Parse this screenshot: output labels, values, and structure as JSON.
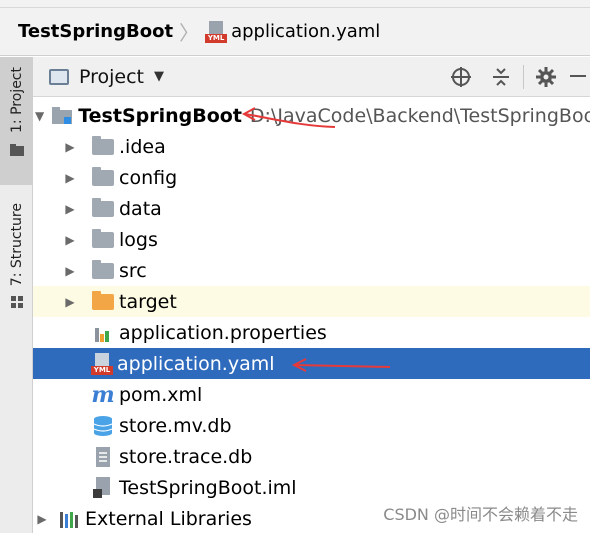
{
  "breadcrumb": {
    "root": "TestSpringBoot",
    "file": "application.yaml",
    "file_icon_tag": "YML"
  },
  "sidebar": {
    "tab_project": "1: Project",
    "tab_structure": "7: Structure"
  },
  "panel": {
    "title": "Project",
    "tools": [
      "crosshair-icon",
      "collapse-icon",
      "gear-icon",
      "minimize-icon"
    ]
  },
  "tree": {
    "root_name": "TestSpringBoot",
    "root_path": "D:\\JavaCode\\Backend\\TestSpringBoo",
    "folders": [
      ".idea",
      "config",
      "data",
      "logs",
      "src",
      "target"
    ],
    "files": [
      "application.properties",
      "application.yaml",
      "pom.xml",
      "store.mv.db",
      "store.trace.db",
      "TestSpringBoot.iml"
    ],
    "external": "External Libraries"
  },
  "watermark": "CSDN @时间不会赖着不走",
  "colors": {
    "selection": "#2f6bbd",
    "annotation_arrow": "#e63a3a",
    "target_folder": "#f3a646"
  }
}
